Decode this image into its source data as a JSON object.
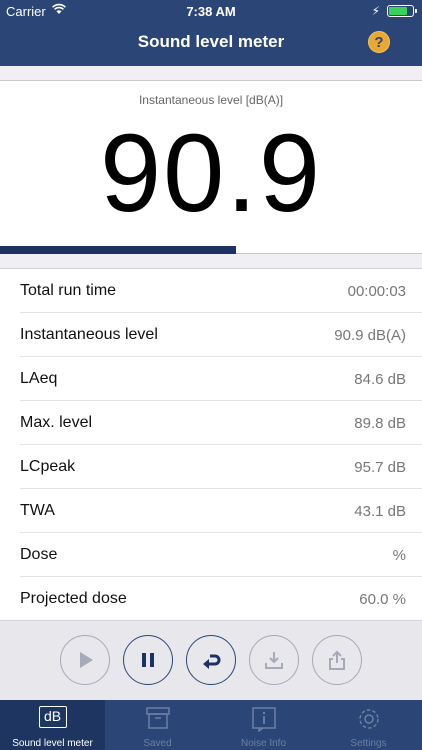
{
  "status": {
    "carrier": "Carrier",
    "time": "7:38 AM"
  },
  "nav": {
    "title": "Sound level meter",
    "help": "?"
  },
  "meter": {
    "label": "Instantaneous level [dB(A)]",
    "value": "90.9",
    "level_fraction": 0.56
  },
  "stats": [
    {
      "name": "Total run time",
      "value": "00:00:03"
    },
    {
      "name": "Instantaneous level",
      "value": "90.9 dB(A)"
    },
    {
      "name": "LAeq",
      "value": "84.6 dB"
    },
    {
      "name": "Max. level",
      "value": "89.8 dB"
    },
    {
      "name": "LCpeak",
      "value": "95.7 dB"
    },
    {
      "name": "TWA",
      "value": "43.1 dB"
    },
    {
      "name": "Dose",
      "value": "%"
    },
    {
      "name": "Projected dose",
      "value": "60.0 %"
    }
  ],
  "controls": [
    "play-icon",
    "pause-icon",
    "reset-icon",
    "download-icon",
    "share-icon"
  ],
  "tabs": [
    {
      "label": "Sound level meter",
      "icon": "dB",
      "active": true
    },
    {
      "label": "Saved",
      "active": false
    },
    {
      "label": "Noise Info",
      "active": false
    },
    {
      "label": "Settings",
      "active": false
    }
  ],
  "colors": {
    "nav": "#2b4576",
    "accent": "#1e3163",
    "help": "#e8a833"
  }
}
